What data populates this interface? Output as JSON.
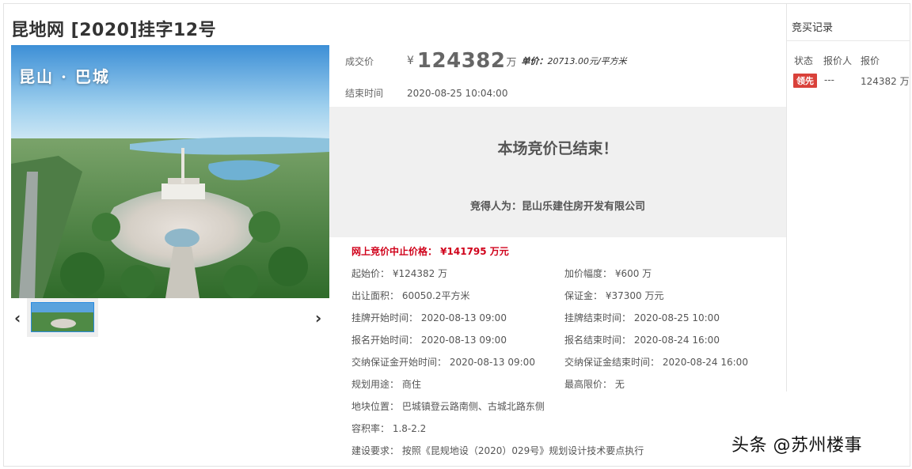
{
  "title": "昆地网 [2020]挂字12号",
  "gallery": {
    "caption": "昆山 · 巴城",
    "prev_icon": "‹",
    "next_icon": "›"
  },
  "deal": {
    "price_label": "成交价",
    "currency": "¥",
    "price": "124382",
    "price_unit": "万",
    "unit_price_label": "单价：",
    "unit_price": "20713.00元/平方米",
    "end_time_label": "结束时间",
    "end_time": "2020-08-25 10:04:00"
  },
  "status": {
    "message": "本场竞价已结束！",
    "winner": "竞得人为：昆山乐建住房开发有限公司"
  },
  "stop_price": "网上竞价中止价格： ¥141795 万元",
  "details": {
    "start_price": "起始价： ¥124382 万",
    "increment": "加价幅度： ¥600 万",
    "area": "出让面积： 60050.2平方米",
    "deposit": "保证金： ¥37300 万元",
    "listing_start": "挂牌开始时间： 2020-08-13 09:00",
    "listing_end": "挂牌结束时间： 2020-08-25 10:00",
    "signup_start": "报名开始时间： 2020-08-13 09:00",
    "signup_end": "报名结束时间： 2020-08-24 16:00",
    "deposit_start": "交纳保证金开始时间： 2020-08-13 09:00",
    "deposit_end": "交纳保证金结束时间： 2020-08-24 16:00",
    "usage": "规划用途： 商住",
    "max_price": "最高限价： 无",
    "location": "地块位置： 巴城镇登云路南侧、古城北路东侧",
    "far": "容积率： 1.8-2.2",
    "requirements": "建设要求： 按照《昆规地设（2020）029号》规划设计技术要点执行"
  },
  "records": {
    "title": "竞买记录",
    "headers": [
      "状态",
      "报价人",
      "报价"
    ],
    "rows": [
      {
        "status": "领先",
        "bidder": "---",
        "price": "124382 万"
      }
    ]
  },
  "watermark": "头条 @苏州楼事"
}
